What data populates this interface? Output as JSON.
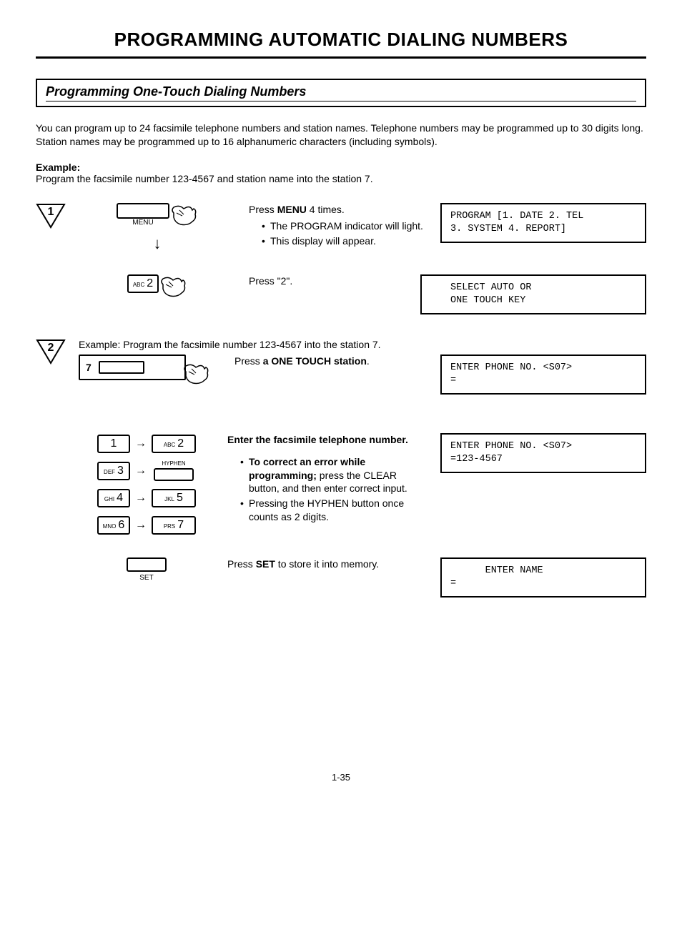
{
  "title": "PROGRAMMING AUTOMATIC DIALING NUMBERS",
  "section_title": "Programming One-Touch Dialing Numbers",
  "intro": "You can program up to 24 facsimile telephone numbers and station names. Telephone numbers may be programmed up to 30 digits long. Station names may be programmed up to 16 alphanumeric characters (including symbols).",
  "example_label": "Example:",
  "example_text": "Program the facsimile number 123-4567 and station name into the station 7.",
  "step1": {
    "marker": "1",
    "menu_label": "MENU",
    "instr_prefix": "Press ",
    "instr_bold": "MENU",
    "instr_suffix": " 4 times.",
    "bullet1": "The PROGRAM indicator will light.",
    "bullet2": "This display will appear.",
    "display": "PROGRAM [1. DATE 2. TEL\n3. SYSTEM 4. REPORT]"
  },
  "step1b": {
    "key_sup": "ABC",
    "key_num": "2",
    "instr": "Press \"2\".",
    "display": "SELECT AUTO OR\nONE TOUCH KEY"
  },
  "step2": {
    "marker": "2",
    "example_label": "Example:",
    "example_text": "Program the facsimile number 123-4567 into the station 7.",
    "instr_prefix": "Press ",
    "instr_bold": "a ONE TOUCH station",
    "instr_suffix": ".",
    "station_num": "7",
    "display": "ENTER PHONE NO. <S07>\n="
  },
  "step3": {
    "instr": "Enter the facsimile telephone number.",
    "bullet1_bold": "To correct an error while programming;",
    "bullet1_rest": " press the CLEAR button, and then enter correct input.",
    "bullet2": "Pressing the HYPHEN button once counts as 2 digits.",
    "display": "ENTER PHONE NO. <S07>\n=123-4567",
    "keys": {
      "k1": "1",
      "k2s": "ABC",
      "k2": "2",
      "k3s": "DEF",
      "k3": "3",
      "hyphen": "HYPHEN",
      "k4s": "GHI",
      "k4": "4",
      "k5s": "JKL",
      "k5": "5",
      "k6s": "MNO",
      "k6": "6",
      "k7s": "PRS",
      "k7": "7"
    }
  },
  "step4": {
    "set_label": "SET",
    "instr_prefix": "Press ",
    "instr_bold": "SET",
    "instr_suffix": " to store it into memory.",
    "display": "      ENTER NAME\n="
  },
  "page_number": "1-35"
}
